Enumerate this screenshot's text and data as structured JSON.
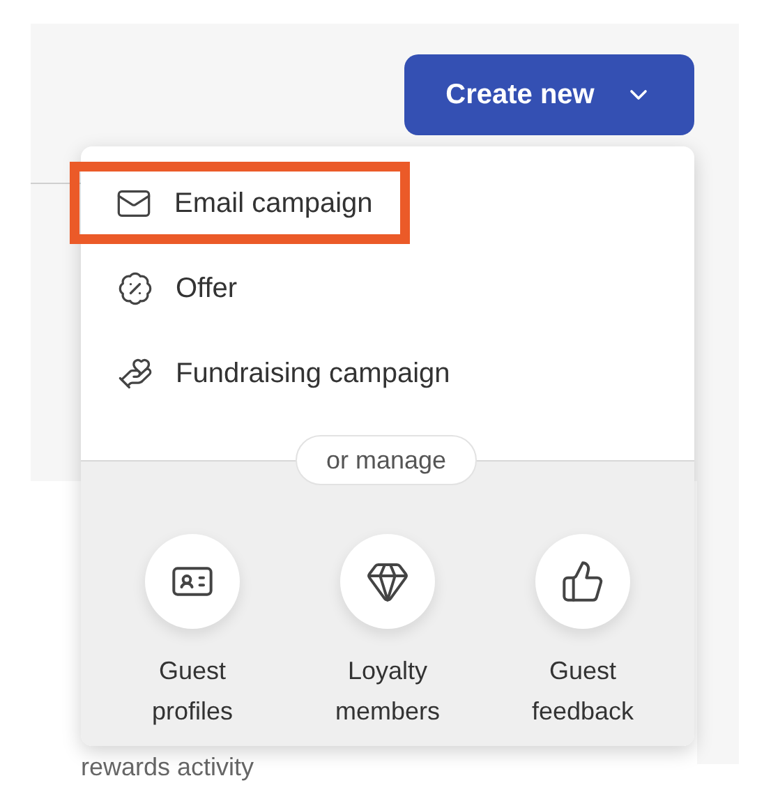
{
  "button": {
    "label": "Create new"
  },
  "menu": {
    "items": [
      {
        "label": "Email campaign",
        "highlighted": true
      },
      {
        "label": "Offer",
        "highlighted": false
      },
      {
        "label": "Fundraising campaign",
        "highlighted": false
      }
    ],
    "divider_label": "or manage",
    "shortcuts": [
      {
        "label": "Guest profiles"
      },
      {
        "label": "Loyalty members"
      },
      {
        "label": "Guest feedback"
      }
    ]
  },
  "background_text": "rewards activity"
}
